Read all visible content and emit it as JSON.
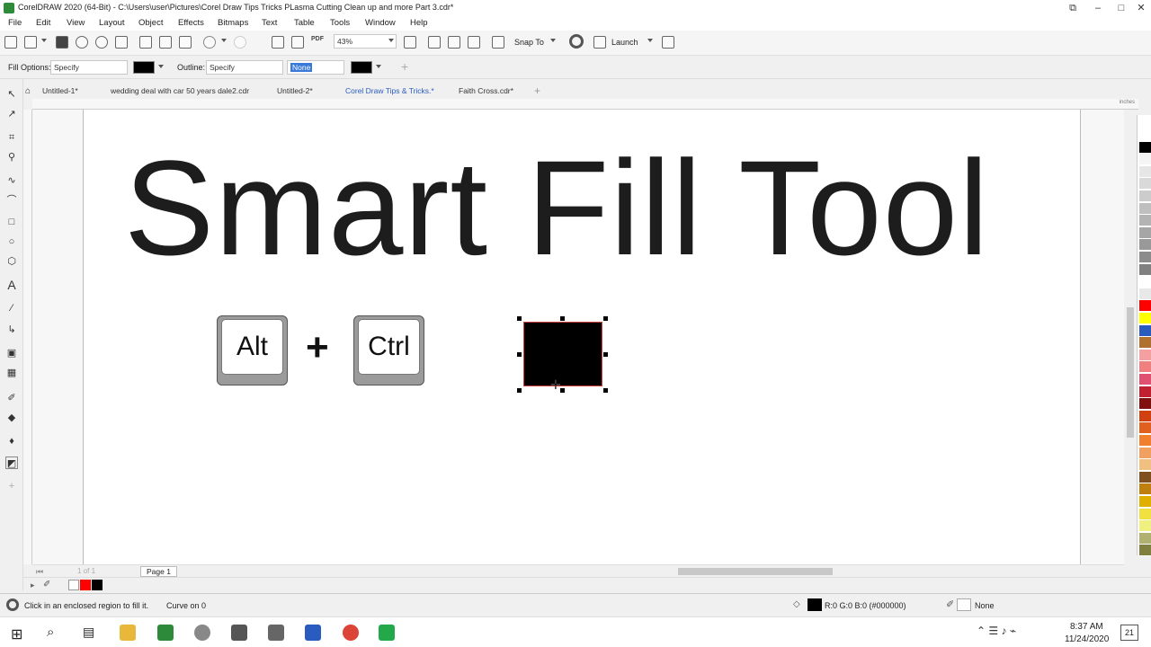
{
  "window": {
    "title": "CorelDRAW 2020 (64-Bit) - C:\\Users\\user\\Pictures\\Corel Draw Tips  Tricks PLasma Cutting Clean up and more Part 3.cdr*"
  },
  "menu": [
    "File",
    "Edit",
    "View",
    "Layout",
    "Object",
    "Effects",
    "Bitmaps",
    "Text",
    "Table",
    "Tools",
    "Window",
    "Help"
  ],
  "toolbar": {
    "zoom": "43%",
    "snap_to": "Snap To",
    "launch": "Launch",
    "pdf_label": "PDF"
  },
  "property_bar": {
    "fill_options_label": "Fill Options:",
    "fill_options_value": "Specify",
    "outline_label": "Outline:",
    "outline_value": "Specify",
    "outline_width": "None"
  },
  "tabs": [
    {
      "label": "Untitled-1*",
      "active": false
    },
    {
      "label": "wedding deal with car 50 years dale2.cdr",
      "active": false
    },
    {
      "label": "Untitled-2*",
      "active": false
    },
    {
      "label": "Corel Draw Tips & Tricks.*",
      "active": true
    },
    {
      "label": "Faith Cross.cdr*",
      "active": false
    }
  ],
  "ruler_units": "inches",
  "canvas": {
    "headline": "Smart Fill Tool",
    "key_alt": "Alt",
    "plus": "+",
    "key_ctrl": "Ctrl"
  },
  "page_nav": {
    "page_label": "Page 1",
    "page_of": "1 of 1"
  },
  "status": {
    "hint": "Click in an enclosed region to fill it.",
    "curve_info": "Curve on 0",
    "fill_color": "R:0 G:0 B:0 (#000000)",
    "outline_status": "None"
  },
  "palette_colors": [
    "#ffffff",
    "#000000",
    "#f5f5f5",
    "#e6e6e6",
    "#d9d9d9",
    "#cccccc",
    "#bfbfbf",
    "#b3b3b3",
    "#a6a6a6",
    "#999999",
    "#8c8c8c",
    "#808080",
    "#ffffff",
    "#e8e8e8",
    "#ff0000",
    "#ffff00",
    "#2a5bbf",
    "#b07030",
    "#f5a0a0",
    "#f08080",
    "#e05070",
    "#c02030",
    "#801010",
    "#d04010",
    "#e06020",
    "#f08030",
    "#f0a060",
    "#f0c080",
    "#805020",
    "#c08010",
    "#e0b000",
    "#f0e040",
    "#f0f080",
    "#b0b070",
    "#808040"
  ],
  "taskbar": {
    "time": "8:37 AM",
    "date": "11/24/2020",
    "notifications": "21"
  }
}
